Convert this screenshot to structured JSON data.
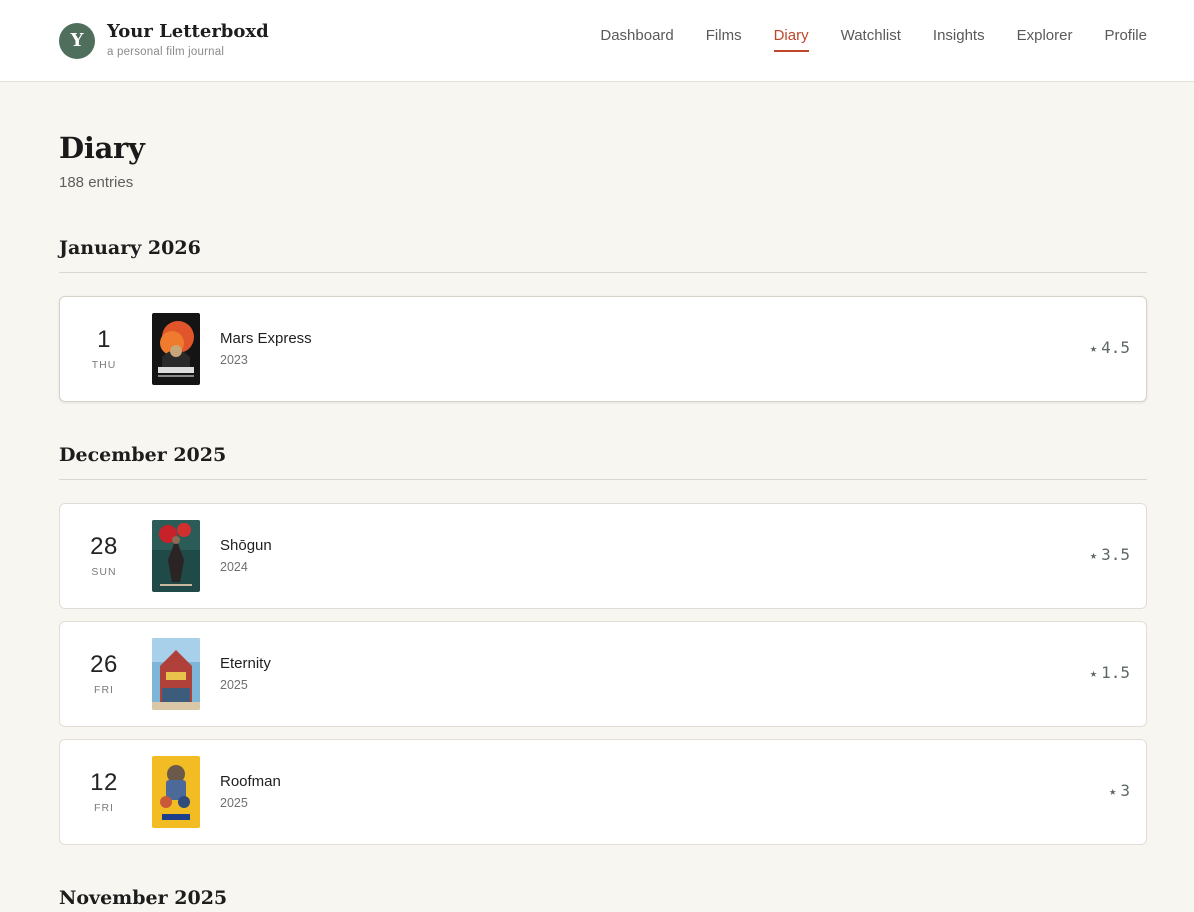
{
  "brand": {
    "avatar_letter": "Y",
    "title": "Your Letterboxd",
    "subtitle": "a personal film journal"
  },
  "nav": {
    "items": [
      {
        "label": "Dashboard",
        "active": false
      },
      {
        "label": "Films",
        "active": false
      },
      {
        "label": "Diary",
        "active": true
      },
      {
        "label": "Watchlist",
        "active": false
      },
      {
        "label": "Insights",
        "active": false
      },
      {
        "label": "Explorer",
        "active": false
      },
      {
        "label": "Profile",
        "active": false
      }
    ]
  },
  "page": {
    "title": "Diary",
    "count": "188 entries"
  },
  "months": [
    {
      "title": "January 2026",
      "entries": [
        {
          "day": "1",
          "weekday": "THU",
          "film": "Mars Express",
          "year": "2023",
          "rating": "4.5",
          "poster_icon": "mars-express-poster"
        }
      ]
    },
    {
      "title": "December 2025",
      "entries": [
        {
          "day": "28",
          "weekday": "SUN",
          "film": "Shōgun",
          "year": "2024",
          "rating": "3.5",
          "poster_icon": "shogun-poster"
        },
        {
          "day": "26",
          "weekday": "FRI",
          "film": "Eternity",
          "year": "2025",
          "rating": "1.5",
          "poster_icon": "eternity-poster"
        },
        {
          "day": "12",
          "weekday": "FRI",
          "film": "Roofman",
          "year": "2025",
          "rating": "3",
          "poster_icon": "roofman-poster"
        }
      ]
    },
    {
      "title": "November 2025",
      "entries": []
    }
  ],
  "rating_icon": "star-icon",
  "colors": {
    "accent": "#c0462b",
    "avatar_bg": "#4f6e5b",
    "background": "#f8f6f1",
    "rating_text": "#5d6a64"
  }
}
